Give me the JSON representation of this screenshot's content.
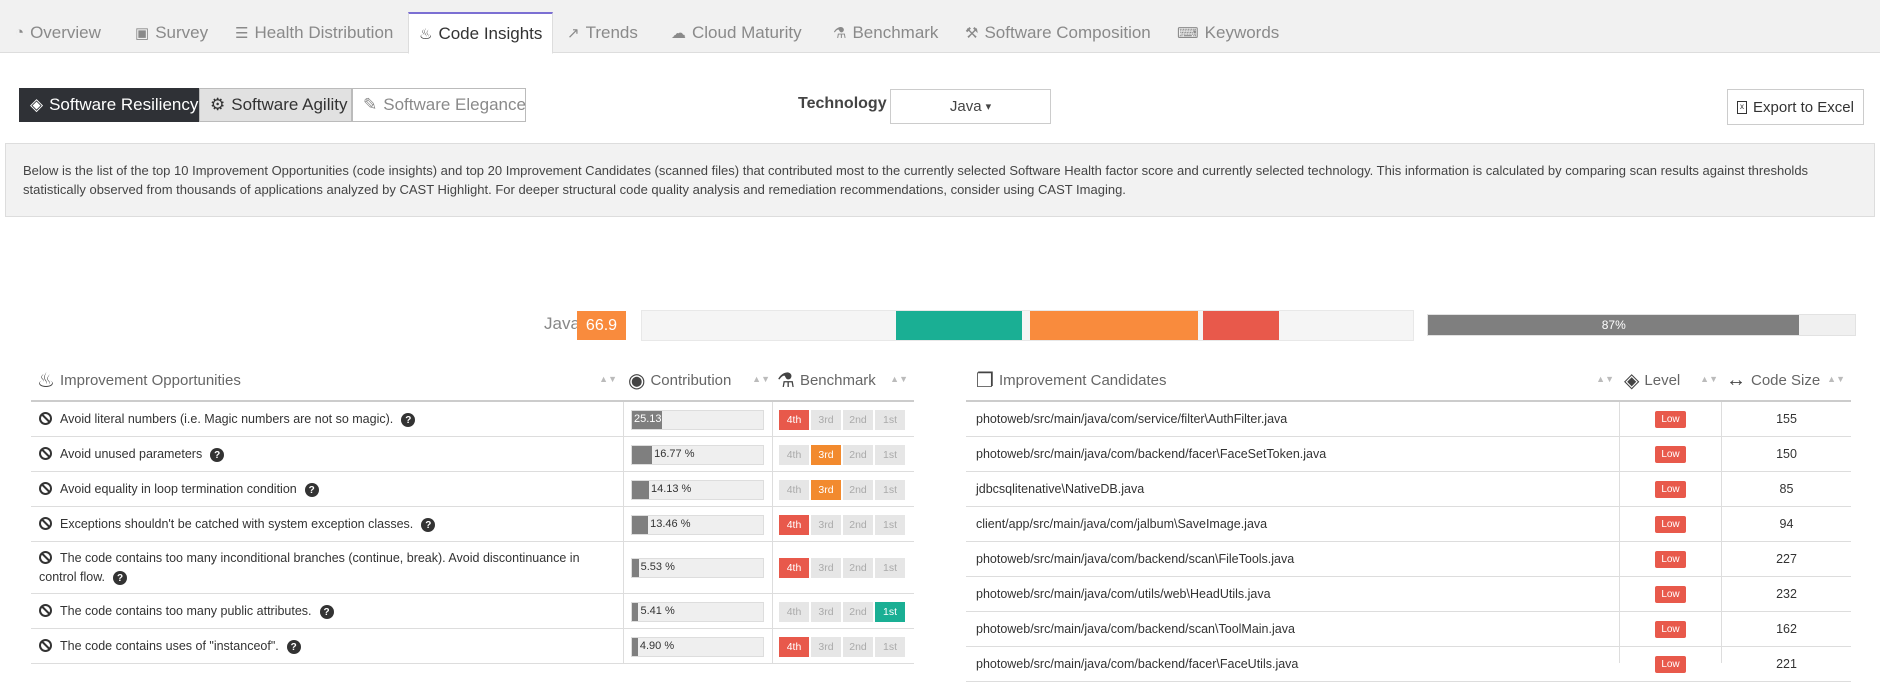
{
  "tabs": [
    {
      "label": "Overview",
      "icon": "dashboard-icon",
      "glyph": "◔"
    },
    {
      "label": "Survey",
      "icon": "briefcase-icon",
      "glyph": "▣"
    },
    {
      "label": "Health Distribution",
      "icon": "checklist-icon",
      "glyph": "☰"
    },
    {
      "label": "Code Insights",
      "icon": "fire-icon",
      "glyph": "♨",
      "active": true
    },
    {
      "label": "Trends",
      "icon": "line-chart-icon",
      "glyph": "↗"
    },
    {
      "label": "Cloud Maturity",
      "icon": "cloud-icon",
      "glyph": "☁"
    },
    {
      "label": "Benchmark",
      "icon": "flask-icon",
      "glyph": "⚗"
    },
    {
      "label": "Software Composition",
      "icon": "hammer-icon",
      "glyph": "⚒"
    },
    {
      "label": "Keywords",
      "icon": "keyboard-icon",
      "glyph": "⌨"
    }
  ],
  "segments": [
    {
      "label": "Software Resiliency",
      "icon": "shield-icon",
      "glyph": "◈",
      "active": true
    },
    {
      "label": "Software Agility",
      "icon": "motorcycle-icon",
      "glyph": "⚙"
    },
    {
      "label": "Software Elegance",
      "icon": "graduation-cap-icon",
      "glyph": "🎓"
    }
  ],
  "technology": {
    "label": "Technology :",
    "value": "Java",
    "caret": "▾"
  },
  "export_label": "Export to Excel",
  "info_text": "Below is the list of the top 10 Improvement Opportunities (code insights) and top 20 Improvement Candidates (scanned files) that contributed most to the currently selected Software Health factor score and currently selected technology. This information is calculated by comparing scan results against thresholds statistically observed from thousands of applications analyzed by CAST Highlight. For deeper structural code quality analysis and remediation recommendations, consider using CAST Imaging.",
  "score": {
    "tech": "Java",
    "value": "66.9",
    "percent_label": "87%",
    "percent": 0.87
  },
  "colors": {
    "red": "#e8594b",
    "orange": "#f28a2e",
    "green": "#1aaf94",
    "gray": "#7f7f7f",
    "active_tab": "#7b6fd3"
  },
  "opportunities_header": {
    "title": "Improvement Opportunities",
    "contribution": "Contribution",
    "benchmark": "Benchmark"
  },
  "benchmark_levels": [
    "4th",
    "3rd",
    "2nd",
    "1st"
  ],
  "opportunities": [
    {
      "text": "Avoid literal numbers (i.e. Magic numbers are not so magic).",
      "contribution": "25.13",
      "pct": 25.13,
      "level": "4th"
    },
    {
      "text": "Avoid unused parameters",
      "contribution": "16.77 %",
      "pct": 16.77,
      "level": "3rd"
    },
    {
      "text": "Avoid equality in loop termination condition",
      "contribution": "14.13 %",
      "pct": 14.13,
      "level": "3rd"
    },
    {
      "text": "Exceptions shouldn't be catched with system exception classes.",
      "contribution": "13.46 %",
      "pct": 13.46,
      "level": "4th"
    },
    {
      "text": "The code contains too many inconditional branches (continue, break). Avoid discontinuance in control flow.",
      "contribution": "5.53 %",
      "pct": 5.53,
      "level": "4th"
    },
    {
      "text": "The code contains too many public attributes.",
      "contribution": "5.41 %",
      "pct": 5.41,
      "level": "1st"
    },
    {
      "text": "The code contains uses of \"instanceof\".",
      "contribution": "4.90 %",
      "pct": 4.9,
      "level": "4th"
    }
  ],
  "candidates_header": {
    "title": "Improvement Candidates",
    "level": "Level",
    "code_size": "Code Size"
  },
  "candidates": [
    {
      "file": "photoweb/src/main/java/com/service/filter\\AuthFilter.java",
      "level": "Low",
      "size": "155"
    },
    {
      "file": "photoweb/src/main/java/com/backend/facer\\FaceSetToken.java",
      "level": "Low",
      "size": "150"
    },
    {
      "file": "jdbcsqlitenative\\NativeDB.java",
      "level": "Low",
      "size": "85"
    },
    {
      "file": "client/app/src/main/java/com/jalbum\\SaveImage.java",
      "level": "Low",
      "size": "94"
    },
    {
      "file": "photoweb/src/main/java/com/backend/scan\\FileTools.java",
      "level": "Low",
      "size": "227"
    },
    {
      "file": "photoweb/src/main/java/com/utils/web\\HeadUtils.java",
      "level": "Low",
      "size": "232"
    },
    {
      "file": "photoweb/src/main/java/com/backend/scan\\ToolMain.java",
      "level": "Low",
      "size": "162"
    },
    {
      "file": "photoweb/src/main/java/com/backend/facer\\FaceUtils.java",
      "level": "Low",
      "size": "221"
    }
  ]
}
